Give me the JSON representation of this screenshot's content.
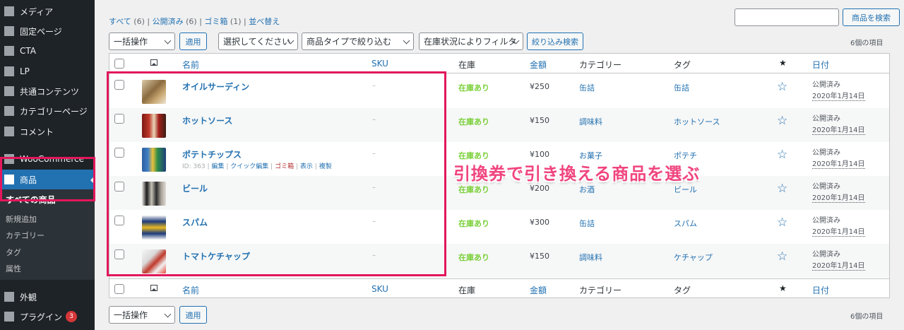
{
  "sidebar": {
    "items": [
      {
        "label": "メディア",
        "icon": "media-icon"
      },
      {
        "label": "固定ページ",
        "icon": "page-icon"
      },
      {
        "label": "CTA",
        "icon": "cta-icon"
      },
      {
        "label": "LP",
        "icon": "lp-icon"
      },
      {
        "label": "共通コンテンツ",
        "icon": "folder-icon"
      },
      {
        "label": "カテゴリーページ",
        "icon": "calendar-icon"
      },
      {
        "label": "コメント",
        "icon": "comment-icon"
      },
      {
        "label": "WooCommerce",
        "icon": "woocommerce-icon"
      },
      {
        "label": "商品",
        "icon": "cube-icon"
      },
      {
        "label": "外観",
        "icon": "brush-icon"
      },
      {
        "label": "プラグイン",
        "icon": "plugin-icon",
        "badge": "3"
      }
    ],
    "submenu": [
      "すべての商品",
      "新規追加",
      "カテゴリー",
      "タグ",
      "属性"
    ]
  },
  "filters": {
    "all": "すべて",
    "all_count": "(6)",
    "published": "公開済み",
    "published_count": "(6)",
    "trash": "ゴミ箱",
    "trash_count": "(1)",
    "sort": "並べ替え",
    "sep": "|"
  },
  "search": {
    "button": "商品を検索",
    "placeholder": ""
  },
  "toolbar": {
    "bulk_action": "一括操作",
    "apply": "適用",
    "category_select": "選択してください",
    "type_select": "商品タイプで絞り込む",
    "stock_select": "在庫状況によりフィルタ",
    "filter_button": "絞り込み検索",
    "items_count": "6個の項目"
  },
  "columns": {
    "name": "名前",
    "sku": "SKU",
    "stock": "在庫",
    "price": "金額",
    "category": "カテゴリー",
    "tag": "タグ",
    "featured": "★",
    "date": "日付"
  },
  "products": [
    {
      "name": "オイルサーディン",
      "sku": "–",
      "stock": "在庫あり",
      "price": "¥250",
      "category": "缶詰",
      "tag": "缶詰",
      "status": "公開済み",
      "date": "2020年1月14日"
    },
    {
      "name": "ホットソース",
      "sku": "–",
      "stock": "在庫あり",
      "price": "¥150",
      "category": "調味料",
      "tag": "ホットソース",
      "status": "公開済み",
      "date": "2020年1月14日"
    },
    {
      "name": "ポテトチップス",
      "sku": "–",
      "stock": "在庫あり",
      "price": "¥100",
      "category": "お菓子",
      "tag": "ポテチ",
      "status": "公開済み",
      "date": "2020年1月14日"
    },
    {
      "name": "ビール",
      "sku": "–",
      "stock": "在庫あり",
      "price": "¥200",
      "category": "お酒",
      "tag": "ビール",
      "status": "公開済み",
      "date": "2020年1月14日"
    },
    {
      "name": "スパム",
      "sku": "–",
      "stock": "在庫あり",
      "price": "¥300",
      "category": "缶詰",
      "tag": "スパム",
      "status": "公開済み",
      "date": "2020年1月14日"
    },
    {
      "name": "トマトケチャップ",
      "sku": "–",
      "stock": "在庫あり",
      "price": "¥150",
      "category": "調味料",
      "tag": "ケチャップ",
      "status": "公開済み",
      "date": "2020年1月14日"
    }
  ],
  "row_actions": {
    "id": "ID: 363",
    "edit": "編集",
    "quick_edit": "クイック編集",
    "trash": "ゴミ箱",
    "view": "表示",
    "duplicate": "複製",
    "sep": "|"
  },
  "annotation": "引換券で引き換える商品を選ぶ",
  "colors": {
    "sidebar_bg": "#1d2327",
    "accent": "#2271b1",
    "in_stock": "#7ad03a",
    "highlight": "#e3175b",
    "annotation_text": "#f0457e"
  }
}
